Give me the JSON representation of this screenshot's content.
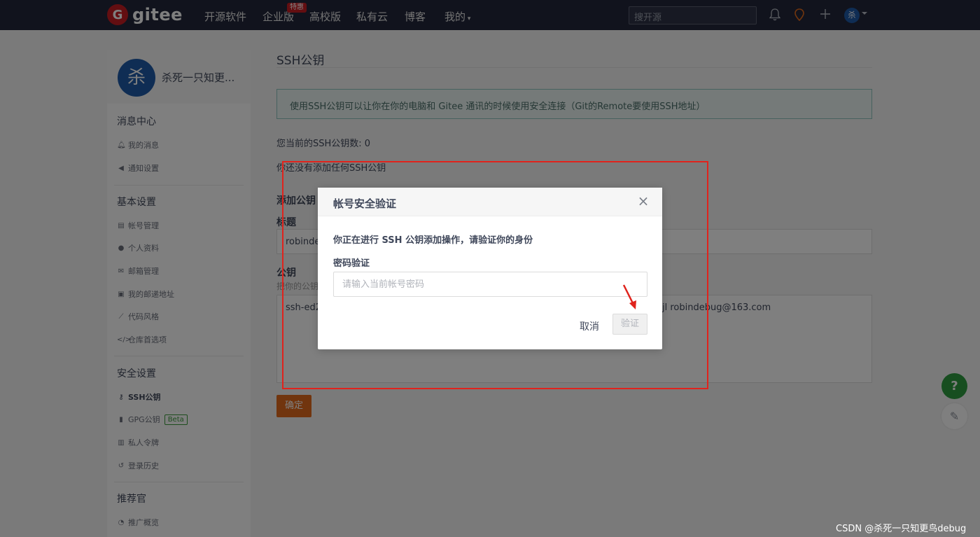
{
  "nav": {
    "logo_mark": "G",
    "logo_text": "gitee",
    "items": [
      "开源软件",
      "企业版",
      "高校版",
      "私有云",
      "博客",
      "我的"
    ],
    "enterprise_badge": "特惠",
    "search_placeholder": "搜开源",
    "avatar_letter": "杀"
  },
  "sidebar": {
    "avatar_letter": "杀",
    "user_name": "杀死一只知更...",
    "sections": [
      {
        "heading": "消息中心",
        "items": [
          "我的消息",
          "通知设置"
        ]
      },
      {
        "heading": "基本设置",
        "items": [
          "帐号管理",
          "个人资料",
          "邮箱管理",
          "我的邮递地址",
          "代码风格",
          "仓库首选项"
        ]
      },
      {
        "heading": "安全设置",
        "items": [
          "SSH公钥",
          "GPG公钥",
          "私人令牌",
          "登录历史"
        ]
      },
      {
        "heading": "推荐官",
        "items": [
          "推广概览"
        ]
      }
    ],
    "beta_label": "Beta"
  },
  "main": {
    "title": "SSH公钥",
    "info": "使用SSH公钥可以让你在你的电脑和 Gitee 通讯的时候使用安全连接（Git的Remote要使用SSH地址）",
    "count_text": "您当前的SSH公钥数: 0",
    "empty_text": "你还没有添加任何SSH公钥",
    "add_heading": "添加公钥",
    "title_label": "标题",
    "title_value": "robinde",
    "key_label": "公钥",
    "key_hint": "把你的公钥",
    "key_value_start": "ssh-ed2",
    "key_value_end": "jl robindebug@163.com",
    "confirm_label": "确定"
  },
  "modal": {
    "title": "帐号安全验证",
    "close_icon": "×",
    "description": "你正在进行 SSH 公钥添加操作，请验证你的身份",
    "password_label": "密码验证",
    "password_placeholder": "请输入当前帐号密码",
    "cancel_label": "取消",
    "verify_label": "验证"
  },
  "floating": {
    "help": "?",
    "edit": "✎"
  },
  "watermark": "CSDN @杀死一只知更鸟debug",
  "colors": {
    "nav_bg": "#23273a",
    "brand_red": "#c71d23",
    "confirm_orange": "#e26b1c",
    "help_green": "#2e9c40",
    "annotation_red": "#e0231c"
  }
}
